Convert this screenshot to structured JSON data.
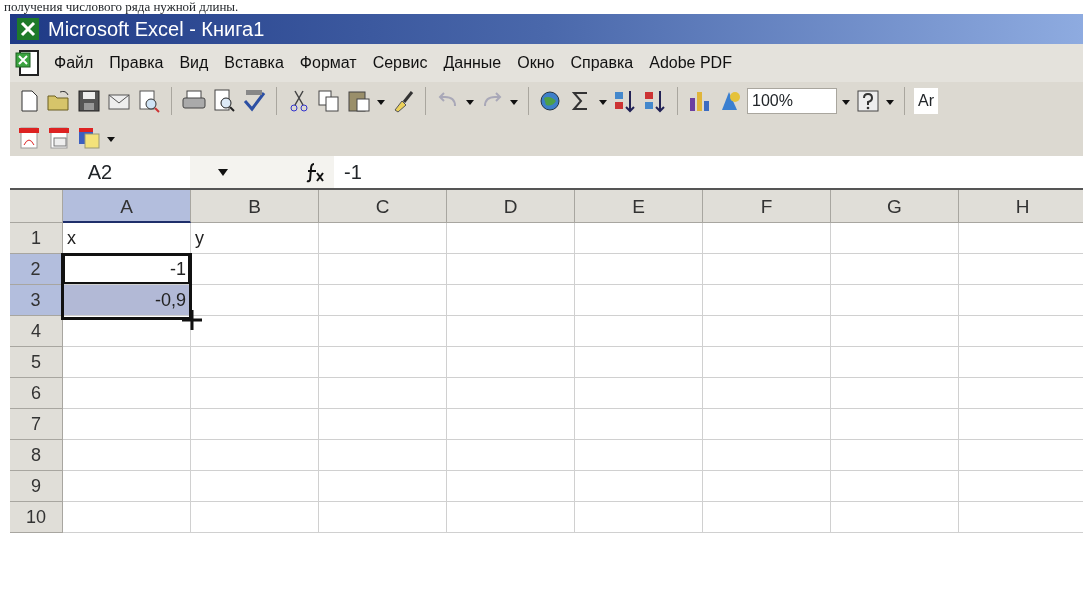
{
  "document_text": "получения числового ряда нужной длины.",
  "window": {
    "title": "Microsoft Excel - Книга1"
  },
  "menu": [
    {
      "label": "Файл"
    },
    {
      "label": "Правка"
    },
    {
      "label": "Вид"
    },
    {
      "label": "Вставка"
    },
    {
      "label": "Формат"
    },
    {
      "label": "Сервис"
    },
    {
      "label": "Данные"
    },
    {
      "label": "Окно"
    },
    {
      "label": "Справка"
    },
    {
      "label": "Adobe PDF"
    }
  ],
  "toolbar": {
    "zoom": "100%",
    "font": "Ar"
  },
  "formula_bar": {
    "name_box": "A2",
    "formula": "-1"
  },
  "columns": [
    {
      "label": "A",
      "selected": true
    },
    {
      "label": "B",
      "selected": false
    },
    {
      "label": "C",
      "selected": false
    },
    {
      "label": "D",
      "selected": false
    },
    {
      "label": "E",
      "selected": false
    },
    {
      "label": "F",
      "selected": false
    },
    {
      "label": "G",
      "selected": false
    },
    {
      "label": "H",
      "selected": false
    }
  ],
  "rows": [
    {
      "label": "1",
      "selected": false,
      "cells": [
        {
          "value": "x",
          "kind": "text",
          "selected": false,
          "active": false
        },
        {
          "value": "y",
          "kind": "text",
          "selected": false,
          "active": false
        },
        {
          "selected": false,
          "active": false
        },
        {
          "selected": false,
          "active": false
        },
        {
          "selected": false,
          "active": false
        },
        {
          "selected": false,
          "active": false
        },
        {
          "selected": false,
          "active": false
        },
        {
          "selected": false,
          "active": false
        }
      ]
    },
    {
      "label": "2",
      "selected": true,
      "cells": [
        {
          "value": "-1",
          "kind": "number",
          "selected": true,
          "active": true
        },
        {
          "selected": false,
          "active": false
        },
        {
          "selected": false,
          "active": false
        },
        {
          "selected": false,
          "active": false
        },
        {
          "selected": false,
          "active": false
        },
        {
          "selected": false,
          "active": false
        },
        {
          "selected": false,
          "active": false
        },
        {
          "selected": false,
          "active": false
        }
      ]
    },
    {
      "label": "3",
      "selected": true,
      "cells": [
        {
          "value": "-0,9",
          "kind": "number",
          "selected": true,
          "active": false
        },
        {
          "selected": false,
          "active": false
        },
        {
          "selected": false,
          "active": false
        },
        {
          "selected": false,
          "active": false
        },
        {
          "selected": false,
          "active": false
        },
        {
          "selected": false,
          "active": false
        },
        {
          "selected": false,
          "active": false
        },
        {
          "selected": false,
          "active": false
        }
      ]
    },
    {
      "label": "4",
      "selected": false,
      "cells": [
        {
          "selected": false,
          "active": false
        },
        {
          "selected": false,
          "active": false
        },
        {
          "selected": false,
          "active": false
        },
        {
          "selected": false,
          "active": false
        },
        {
          "selected": false,
          "active": false
        },
        {
          "selected": false,
          "active": false
        },
        {
          "selected": false,
          "active": false
        },
        {
          "selected": false,
          "active": false
        }
      ]
    },
    {
      "label": "5",
      "selected": false,
      "cells": [
        {
          "selected": false,
          "active": false
        },
        {
          "selected": false,
          "active": false
        },
        {
          "selected": false,
          "active": false
        },
        {
          "selected": false,
          "active": false
        },
        {
          "selected": false,
          "active": false
        },
        {
          "selected": false,
          "active": false
        },
        {
          "selected": false,
          "active": false
        },
        {
          "selected": false,
          "active": false
        }
      ]
    },
    {
      "label": "6",
      "selected": false,
      "cells": [
        {
          "selected": false,
          "active": false
        },
        {
          "selected": false,
          "active": false
        },
        {
          "selected": false,
          "active": false
        },
        {
          "selected": false,
          "active": false
        },
        {
          "selected": false,
          "active": false
        },
        {
          "selected": false,
          "active": false
        },
        {
          "selected": false,
          "active": false
        },
        {
          "selected": false,
          "active": false
        }
      ]
    },
    {
      "label": "7",
      "selected": false,
      "cells": [
        {
          "selected": false,
          "active": false
        },
        {
          "selected": false,
          "active": false
        },
        {
          "selected": false,
          "active": false
        },
        {
          "selected": false,
          "active": false
        },
        {
          "selected": false,
          "active": false
        },
        {
          "selected": false,
          "active": false
        },
        {
          "selected": false,
          "active": false
        },
        {
          "selected": false,
          "active": false
        }
      ]
    },
    {
      "label": "8",
      "selected": false,
      "cells": [
        {
          "selected": false,
          "active": false
        },
        {
          "selected": false,
          "active": false
        },
        {
          "selected": false,
          "active": false
        },
        {
          "selected": false,
          "active": false
        },
        {
          "selected": false,
          "active": false
        },
        {
          "selected": false,
          "active": false
        },
        {
          "selected": false,
          "active": false
        },
        {
          "selected": false,
          "active": false
        }
      ]
    },
    {
      "label": "9",
      "selected": false,
      "cells": [
        {
          "selected": false,
          "active": false
        },
        {
          "selected": false,
          "active": false
        },
        {
          "selected": false,
          "active": false
        },
        {
          "selected": false,
          "active": false
        },
        {
          "selected": false,
          "active": false
        },
        {
          "selected": false,
          "active": false
        },
        {
          "selected": false,
          "active": false
        },
        {
          "selected": false,
          "active": false
        }
      ]
    },
    {
      "label": "10",
      "selected": false,
      "cells": [
        {
          "selected": false,
          "active": false
        },
        {
          "selected": false,
          "active": false
        },
        {
          "selected": false,
          "active": false
        },
        {
          "selected": false,
          "active": false
        },
        {
          "selected": false,
          "active": false
        },
        {
          "selected": false,
          "active": false
        },
        {
          "selected": false,
          "active": false
        },
        {
          "selected": false,
          "active": false
        }
      ]
    }
  ]
}
